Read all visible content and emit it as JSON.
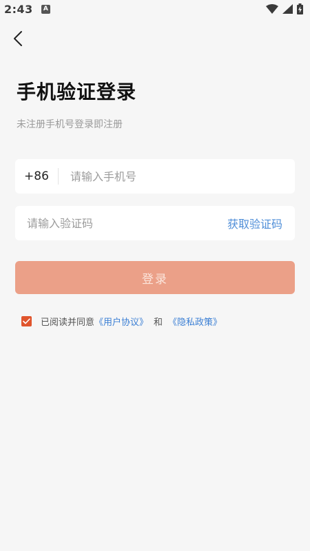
{
  "status_bar": {
    "time": "2:43",
    "app_icon_letter": "A"
  },
  "page": {
    "title": "手机验证登录",
    "subtitle": "未注册手机号登录即注册"
  },
  "phone_field": {
    "country_code": "+86",
    "placeholder": "请输入手机号",
    "value": ""
  },
  "code_field": {
    "placeholder": "请输入验证码",
    "value": "",
    "get_code_label": "获取验证码"
  },
  "login_button": {
    "label": "登录"
  },
  "agreement": {
    "checked": true,
    "prefix": "已阅读并同意",
    "user_agreement": "《用户协议》",
    "and": "和",
    "privacy_policy": "《隐私政策》"
  },
  "colors": {
    "accent": "#e0552d",
    "button_disabled": "#eba088",
    "link": "#4f8ed8",
    "background": "#f6f6f6"
  }
}
